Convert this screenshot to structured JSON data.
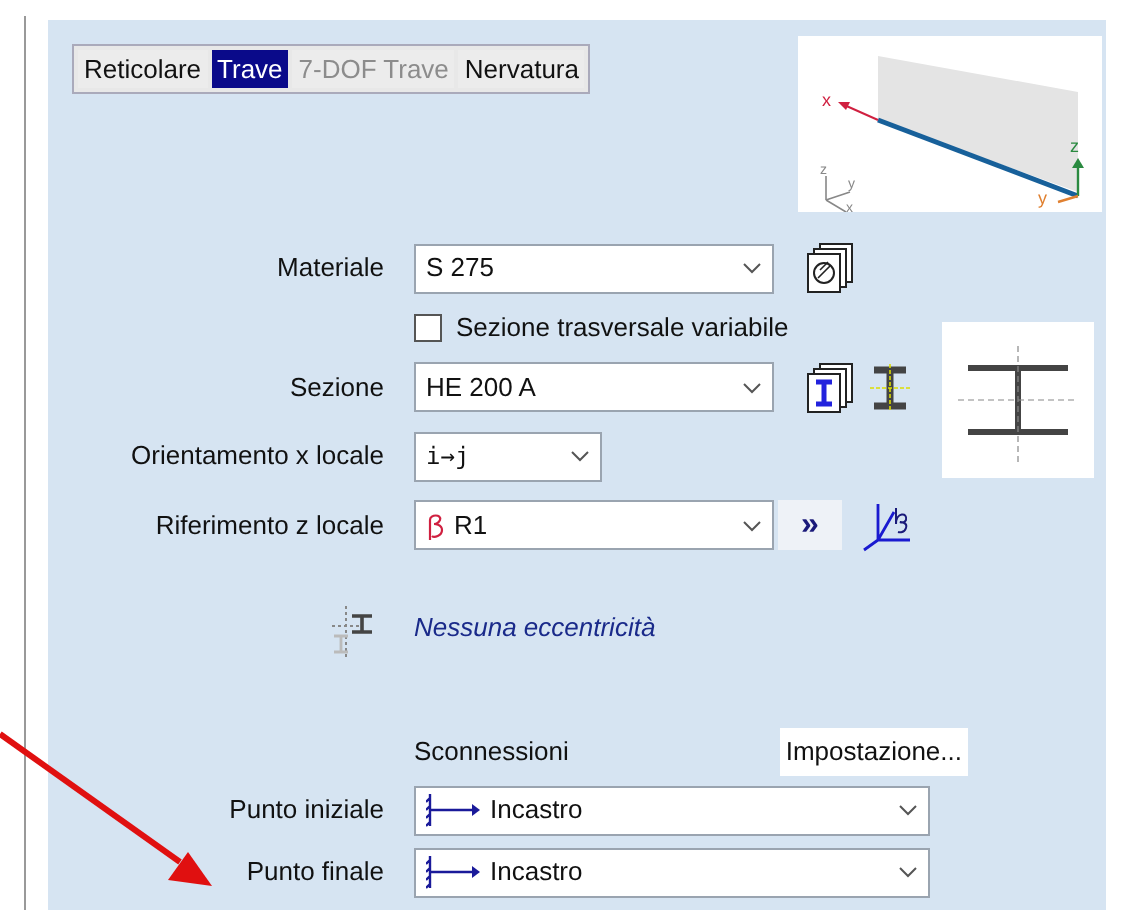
{
  "tabs": [
    {
      "label": "Reticolare",
      "selected": false,
      "disabled": false
    },
    {
      "label": "Trave",
      "selected": true,
      "disabled": false
    },
    {
      "label": "7-DOF Trave",
      "selected": false,
      "disabled": true
    },
    {
      "label": "Nervatura",
      "selected": false,
      "disabled": false
    }
  ],
  "preview": {
    "axis_labels": [
      "x",
      "z",
      "y"
    ],
    "triad_labels": [
      "z",
      "y",
      "x"
    ]
  },
  "material": {
    "label": "Materiale",
    "value": "S 275"
  },
  "variable_section": {
    "label": "Sezione trasversale variabile",
    "checked": false
  },
  "section": {
    "label": "Sezione",
    "value": "HE  200 A"
  },
  "orientation": {
    "label": "Orientamento x locale",
    "value": "i→j"
  },
  "reference": {
    "label": "Riferimento z locale",
    "value": "R1",
    "more_button": "»"
  },
  "eccentricity": {
    "text": "Nessuna eccentricità"
  },
  "releases": {
    "label": "Sconnessioni",
    "button": "Impostazione...",
    "rows": [
      {
        "label": "Punto iniziale",
        "value": "Incastro"
      },
      {
        "label": "Punto finale",
        "value": "Incastro"
      }
    ]
  }
}
